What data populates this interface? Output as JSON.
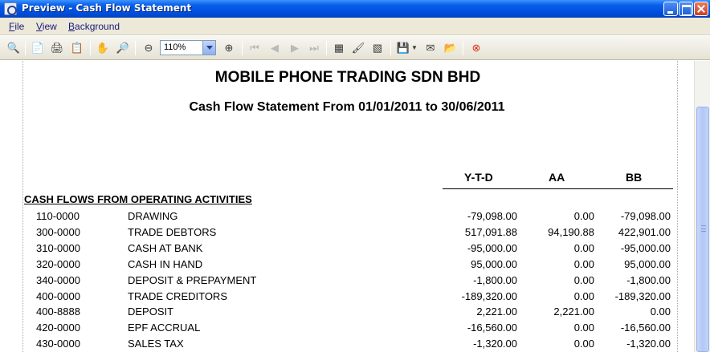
{
  "window": {
    "title": "Preview - Cash Flow Statement"
  },
  "menu": {
    "items": [
      "File",
      "View",
      "Background"
    ]
  },
  "toolbar": {
    "zoom_value": "110%"
  },
  "report": {
    "company": "MOBILE PHONE TRADING SDN  BHD",
    "title": "Cash Flow Statement From 01/01/2011 to 30/06/2011",
    "columns": [
      "Y-T-D",
      "AA",
      "BB"
    ],
    "section_title": "CASH FLOWS FROM OPERATING ACTIVITIES",
    "rows": [
      {
        "code": "110-0000",
        "desc": "DRAWING",
        "ytd": "-79,098.00",
        "aa": "0.00",
        "bb": "-79,098.00"
      },
      {
        "code": "300-0000",
        "desc": "TRADE DEBTORS",
        "ytd": "517,091.88",
        "aa": "94,190.88",
        "bb": "422,901.00"
      },
      {
        "code": "310-0000",
        "desc": "CASH AT BANK",
        "ytd": "-95,000.00",
        "aa": "0.00",
        "bb": "-95,000.00"
      },
      {
        "code": "320-0000",
        "desc": "CASH IN HAND",
        "ytd": "95,000.00",
        "aa": "0.00",
        "bb": "95,000.00"
      },
      {
        "code": "340-0000",
        "desc": "DEPOSIT & PREPAYMENT",
        "ytd": "-1,800.00",
        "aa": "0.00",
        "bb": "-1,800.00"
      },
      {
        "code": "400-0000",
        "desc": "TRADE CREDITORS",
        "ytd": "-189,320.00",
        "aa": "0.00",
        "bb": "-189,320.00"
      },
      {
        "code": "400-8888",
        "desc": "DEPOSIT",
        "ytd": "2,221.00",
        "aa": "2,221.00",
        "bb": "0.00"
      },
      {
        "code": "420-0000",
        "desc": "EPF ACCRUAL",
        "ytd": "-16,560.00",
        "aa": "0.00",
        "bb": "-16,560.00"
      },
      {
        "code": "430-0000",
        "desc": "SALES TAX",
        "ytd": "-1,320.00",
        "aa": "0.00",
        "bb": "-1,320.00"
      }
    ]
  }
}
